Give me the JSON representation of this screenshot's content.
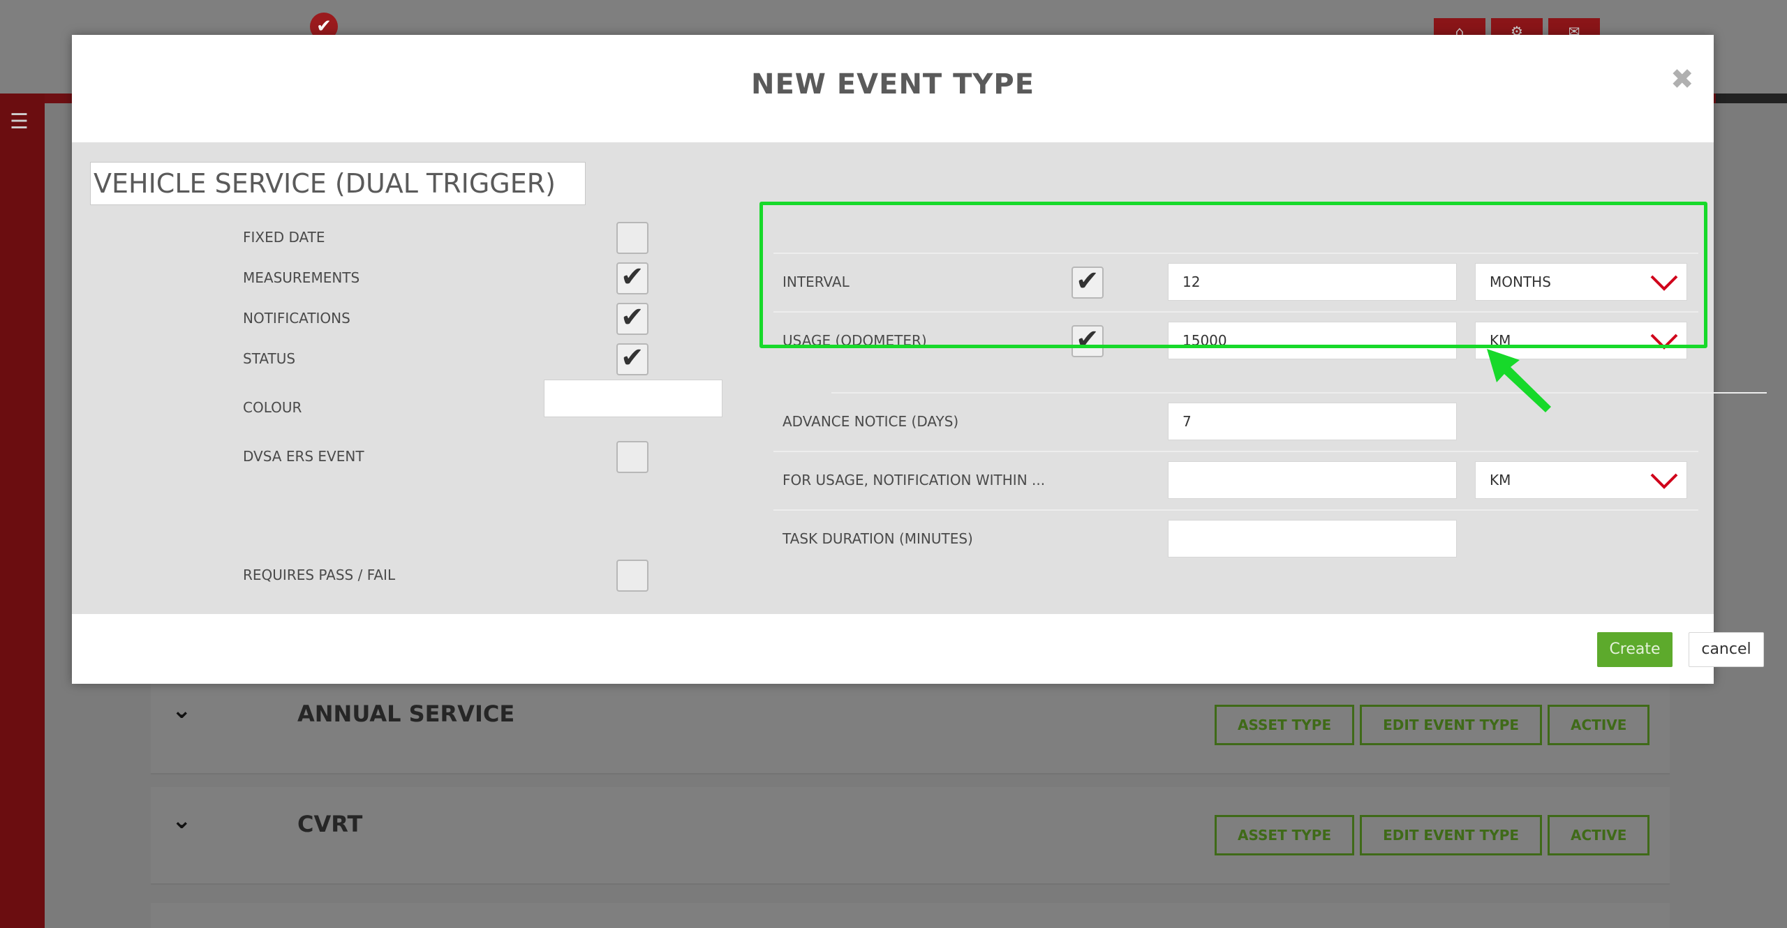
{
  "background": {
    "top_buttons": [
      "⌂",
      "⚙",
      "✉"
    ],
    "event_rows": [
      {
        "title": "ANNUAL SERVICE",
        "buttons": [
          "ASSET TYPE",
          "EDIT EVENT TYPE",
          "ACTIVE"
        ]
      },
      {
        "title": "CVRT",
        "buttons": [
          "ASSET TYPE",
          "EDIT EVENT TYPE",
          "ACTIVE"
        ]
      }
    ]
  },
  "modal": {
    "title": "NEW EVENT TYPE",
    "close_icon": "✖",
    "name_value": "VEHICLE SERVICE (DUAL TRIGGER)",
    "left_fields": [
      {
        "label": "FIXED DATE",
        "checked": false
      },
      {
        "label": "MEASUREMENTS",
        "checked": true
      },
      {
        "label": "NOTIFICATIONS",
        "checked": true
      },
      {
        "label": "STATUS",
        "checked": true
      },
      {
        "label": "COLOUR",
        "value": ""
      },
      {
        "label": "DVSA ERS EVENT",
        "checked": false
      },
      {
        "label": "REQUIRES PASS / FAIL",
        "checked": false
      }
    ],
    "right_fields": {
      "interval": {
        "label": "INTERVAL",
        "checked": true,
        "value": "12",
        "unit": "MONTHS"
      },
      "usage": {
        "label": "USAGE (ODOMETER)",
        "checked": true,
        "value": "15000",
        "unit": "KM"
      },
      "advance_notice": {
        "label": "ADVANCE NOTICE (DAYS)",
        "value": "7"
      },
      "usage_notification": {
        "label": "FOR USAGE, NOTIFICATION WITHIN ...",
        "value": "",
        "unit": "KM"
      },
      "task_duration": {
        "label": "TASK DURATION (MINUTES)",
        "value": ""
      }
    },
    "footer": {
      "create_label": "Create",
      "cancel_label": "cancel"
    }
  },
  "colors": {
    "accent_green": "#17d92a",
    "create_green": "#5daa2c",
    "brand_red": "#8a1518",
    "chevron_red": "#d0021b"
  }
}
